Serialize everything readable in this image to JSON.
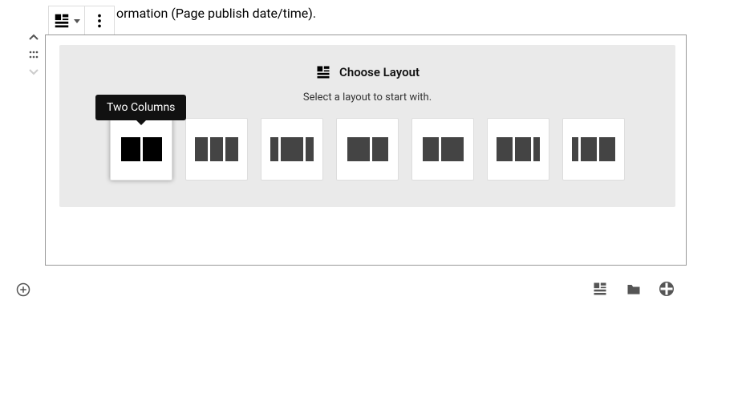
{
  "top_text_fragment": "ormation (Page publish date/time).",
  "layout_chooser": {
    "title": "Choose Layout",
    "subtitle": "Select a layout to start with.",
    "options": [
      {
        "name": "two-columns",
        "cols": 2,
        "active": true
      },
      {
        "name": "three-columns",
        "cols": 3,
        "active": false
      },
      {
        "name": "wide-center",
        "cols": 3,
        "active": false
      },
      {
        "name": "left-wide",
        "cols": 2,
        "active": false
      },
      {
        "name": "right-wide",
        "cols": 2,
        "active": false
      },
      {
        "name": "two-plus-narrow",
        "cols": 3,
        "active": false
      },
      {
        "name": "narrow-plus-two",
        "cols": 3,
        "active": false
      }
    ]
  },
  "tooltip": "Two Columns"
}
